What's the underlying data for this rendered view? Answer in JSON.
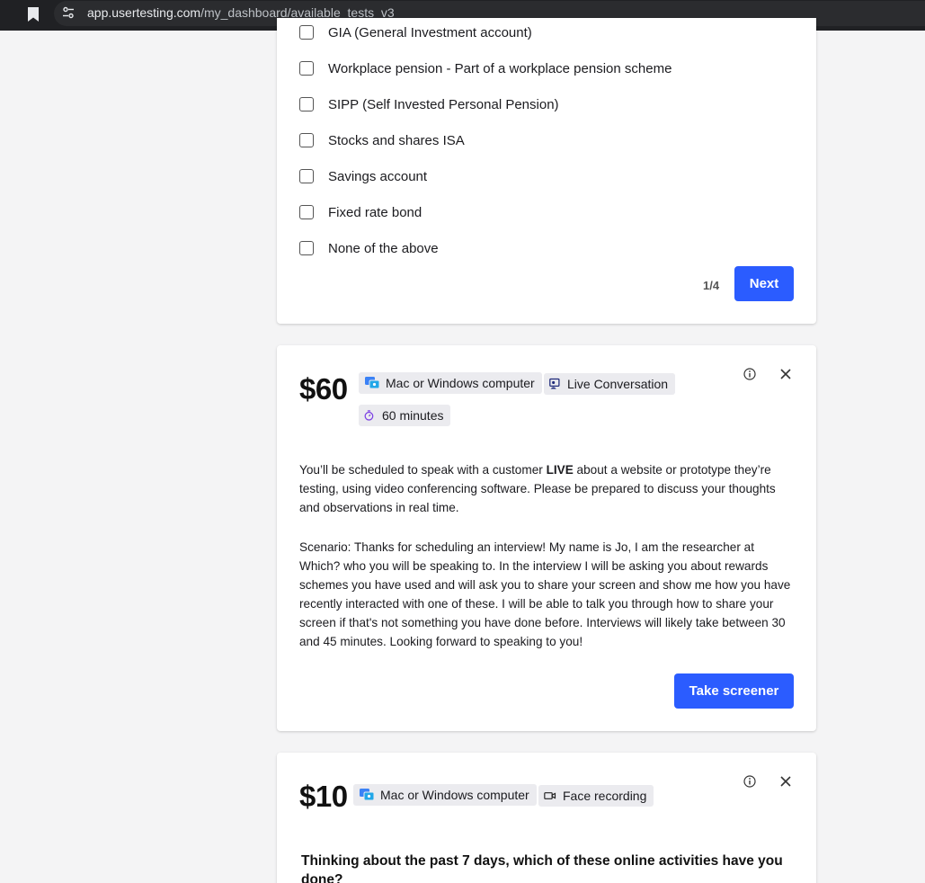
{
  "browser": {
    "url_domain": "app.usertesting.com",
    "url_path": "/my_dashboard/available_tests_v3"
  },
  "screener_card": {
    "options": [
      "GIA (General Investment account)",
      "Workplace pension - Part of a workplace pension scheme",
      "SIPP (Self Invested Personal Pension)",
      "Stocks and shares ISA",
      "Savings account",
      "Fixed rate bond",
      "None of the above"
    ],
    "pager": "1/4",
    "next_label": "Next"
  },
  "test_card_1": {
    "price": "$60",
    "tags": {
      "device": "Mac or Windows computer",
      "type": "Live Conversation",
      "duration": "60 minutes"
    },
    "description": {
      "intro_before": "You’ll be scheduled to speak with a customer ",
      "intro_bold": "LIVE",
      "intro_after": " about a website or prototype they’re testing, using video conferencing software. Please be prepared to discuss your thoughts and observations in real time.",
      "scenario": "Scenario: Thanks for scheduling an interview! My name is Jo, I am the researcher at Which? who you will be speaking to. In the interview I will be asking you about rewards schemes you have used and will ask you to share your screen and show me how you have recently interacted with one of these. I will be able to talk you through how to share your screen if that's not something you have done before. Interviews will likely take between 30 and 45 minutes. Looking forward to speaking to you!"
    },
    "cta_label": "Take screener"
  },
  "test_card_2": {
    "price": "$10",
    "tags": {
      "device": "Mac or Windows computer",
      "type": "Face recording"
    },
    "question": "Thinking about the past 7 days, which of these online activities have you done?"
  },
  "colors": {
    "primary": "#2b5cff",
    "tag_bg": "#ebebef",
    "page_bg": "#f4f4f5",
    "browser_bg": "#202124",
    "duration_icon": "#7b3fe4"
  },
  "icons": [
    "bookmark-icon",
    "site-settings-icon",
    "device-icon",
    "live-conversation-icon",
    "stopwatch-icon",
    "face-recording-icon",
    "info-icon",
    "close-icon"
  ]
}
